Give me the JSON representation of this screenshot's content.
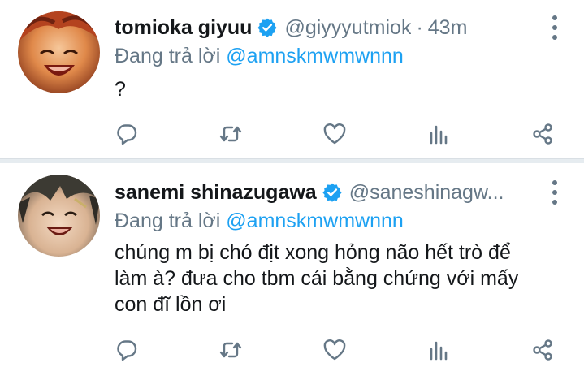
{
  "tweets": [
    {
      "name": "tomioka giyuu",
      "handle": "@giyyyutmiok",
      "separator": "·",
      "time": "43m",
      "reply_prefix": "Đang trả lời",
      "reply_to": "@amnskmwmwnnn",
      "text": "?",
      "verified": true
    },
    {
      "name": "sanemi shinazugawa",
      "handle": "@saneshinagw...",
      "reply_prefix": "Đang trả lời",
      "reply_to": "@amnskmwmwnnn",
      "text": "chúng m bị chó địt xong hỏng não hết trò để\nlàm à? đưa cho tbm cái bằng chứng với mấy\ncon đĩ lồn ơi",
      "verified": true
    }
  ],
  "icons": [
    "reply-icon",
    "retweet-icon",
    "like-icon",
    "analytics-icon",
    "share-icon",
    "more-icon",
    "verified-badge-icon"
  ],
  "colors": {
    "accent": "#1da1f2",
    "secondary_text": "#657786",
    "primary_text": "#14171a",
    "separator": "#e6ecf0"
  }
}
